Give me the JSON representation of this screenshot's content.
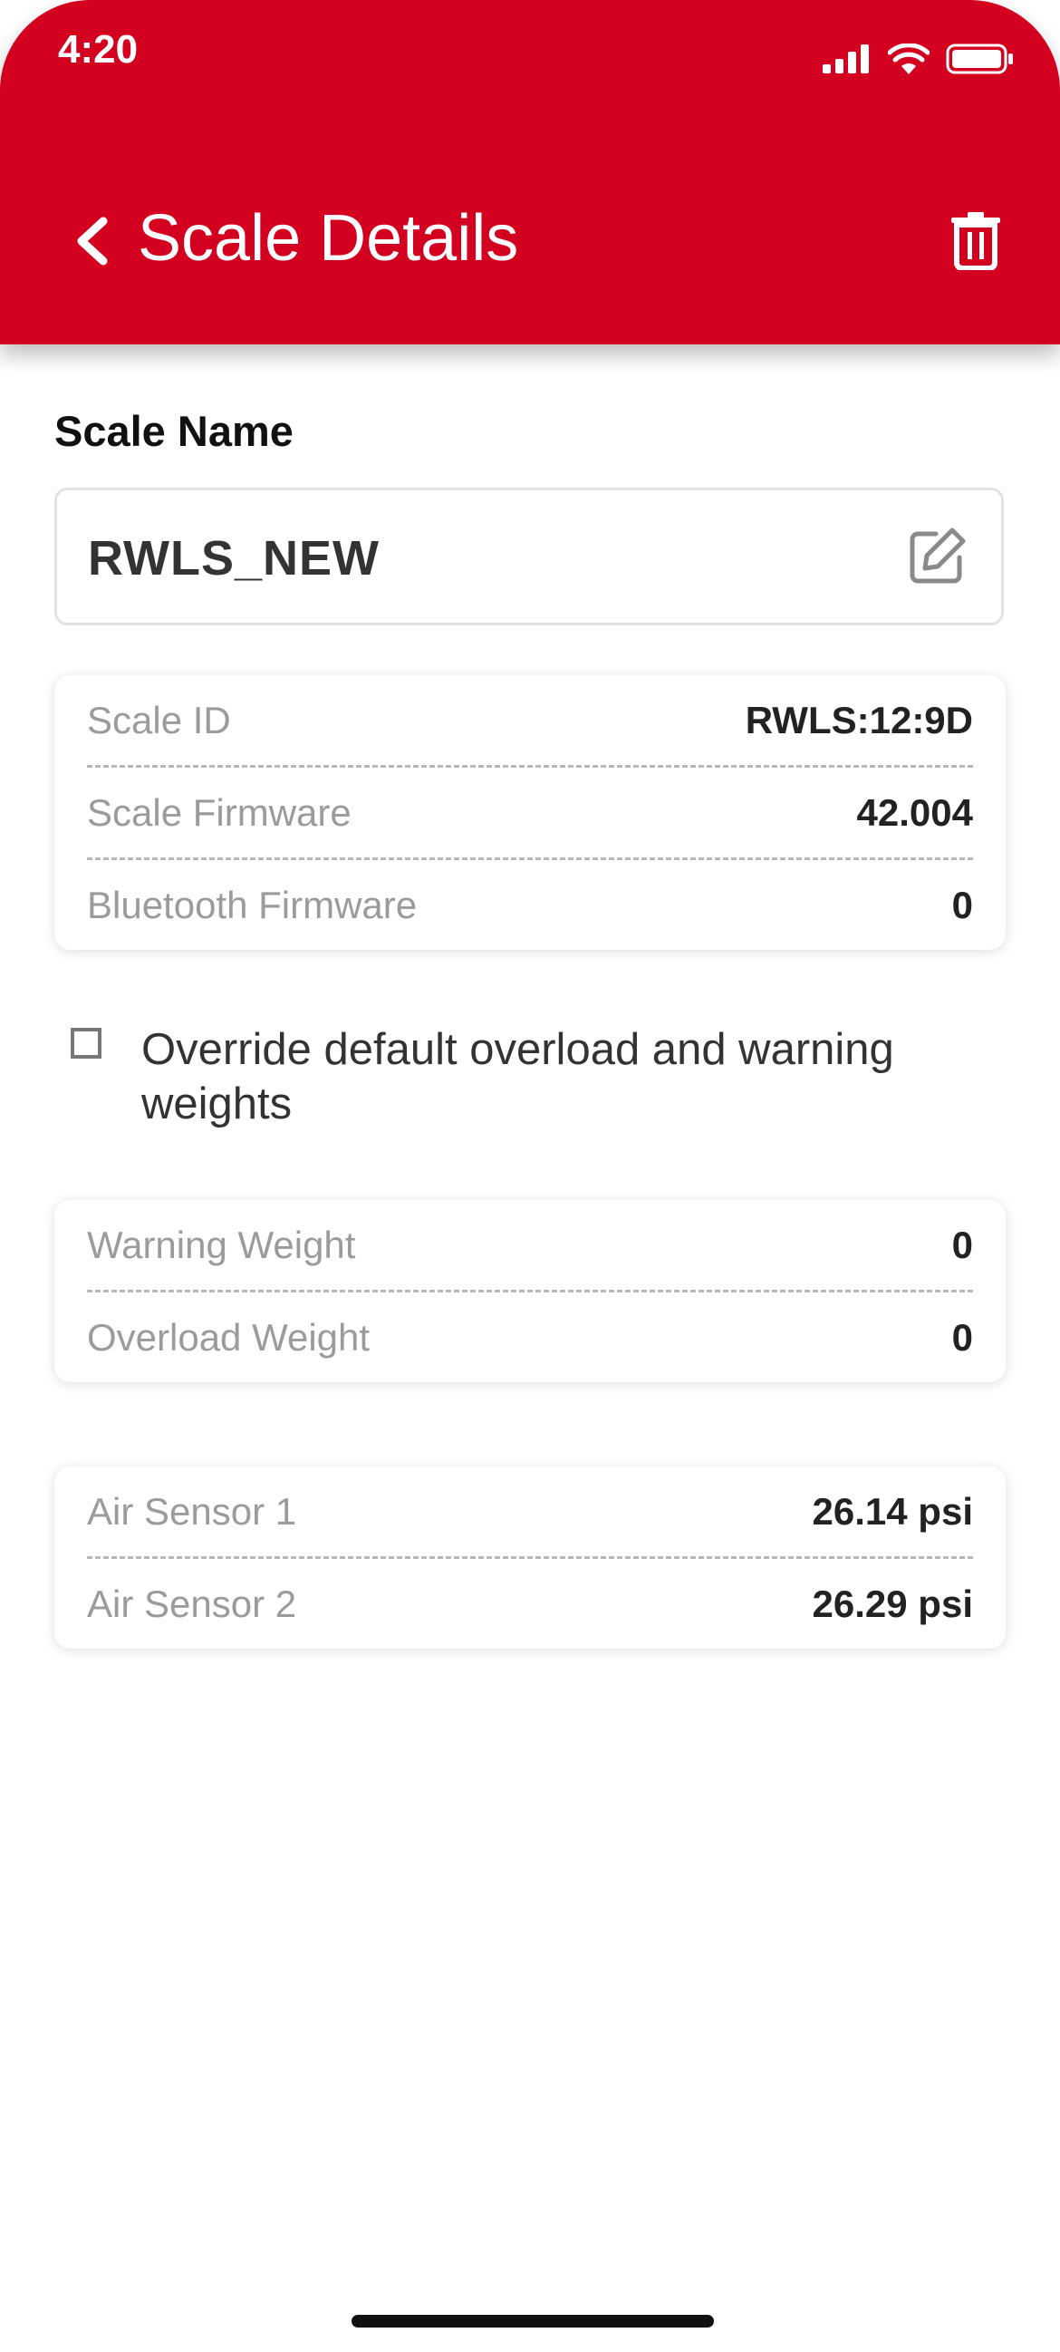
{
  "status_bar": {
    "time": "4:20",
    "icons": [
      "signal-icon",
      "wifi-icon",
      "battery-icon"
    ]
  },
  "header": {
    "title": "Scale Details",
    "background_color": "#d4001f",
    "back_icon": "chevron-left-icon",
    "delete_icon": "trash-icon"
  },
  "scale_name": {
    "label": "Scale Name",
    "value": "RWLS_NEW",
    "edit_icon": "edit-icon"
  },
  "info_card": {
    "rows": [
      {
        "label": "Scale ID",
        "value": "RWLS:12:9D"
      },
      {
        "label": "Scale Firmware",
        "value": "42.004"
      },
      {
        "label": "Bluetooth Firmware",
        "value": "0"
      }
    ]
  },
  "override": {
    "label": "Override default overload and warning weights",
    "checked": false
  },
  "weights_card": {
    "rows": [
      {
        "label": "Warning Weight",
        "value": "0"
      },
      {
        "label": "Overload Weight",
        "value": "0"
      }
    ]
  },
  "sensors_card": {
    "rows": [
      {
        "label": "Air Sensor 1",
        "value": "26.14 psi"
      },
      {
        "label": "Air Sensor 2",
        "value": "26.29 psi"
      }
    ]
  }
}
